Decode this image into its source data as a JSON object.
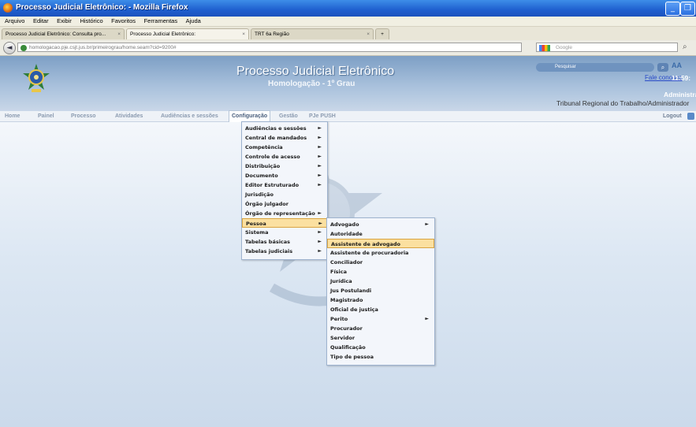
{
  "window": {
    "title": "Processo Judicial Eletrônico: - Mozilla Firefox"
  },
  "menubar": [
    "Arquivo",
    "Editar",
    "Exibir",
    "Histórico",
    "Favoritos",
    "Ferramentas",
    "Ajuda"
  ],
  "tabs": [
    {
      "label": "Processo Judicial Eletrônico: Consulta pro..."
    },
    {
      "label": "Processo Judicial Eletrônico:"
    },
    {
      "label": "TRT 6a Região"
    }
  ],
  "nav": {
    "url": "homologacao.pje.csjt.jus.br/primeirograu/home.seam?cid=9200#",
    "search_placeholder": "Google"
  },
  "header": {
    "title": "Processo Judicial Eletrônico",
    "subtitle": "Homologação - 1º Grau",
    "search_placeholder": "Pesquisar",
    "contact": "Fale conosco",
    "clock": "11:59:",
    "user_role": "Administrad",
    "tribunal": "Tribunal Regional do Trabalho/Administrador"
  },
  "appnav": [
    "Home",
    "Painel",
    "Processo",
    "Atividades",
    "Audiências e sessões",
    "Configuração",
    "Gestão",
    "PJe PUSH"
  ],
  "logout": "Logout",
  "config_menu": [
    {
      "label": "Audiências e sessões",
      "sub": true
    },
    {
      "label": "Central de mandados",
      "sub": true
    },
    {
      "label": "Competência",
      "sub": true
    },
    {
      "label": "Controle de acesso",
      "sub": true
    },
    {
      "label": "Distribuição",
      "sub": true
    },
    {
      "label": "Documento",
      "sub": true
    },
    {
      "label": "Editor Estruturado",
      "sub": true
    },
    {
      "label": "Jurisdição",
      "sub": false
    },
    {
      "label": "Órgão julgador",
      "sub": false
    },
    {
      "label": "Órgão de representação",
      "sub": true
    },
    {
      "label": "Pessoa",
      "sub": true,
      "highlight": true
    },
    {
      "label": "Sistema",
      "sub": true
    },
    {
      "label": "Tabelas básicas",
      "sub": true
    },
    {
      "label": "Tabelas judiciais",
      "sub": true
    }
  ],
  "pessoa_menu": [
    {
      "label": "Advogado",
      "sub": true
    },
    {
      "label": "Autoridade",
      "sub": false
    },
    {
      "label": "Assistente de advogado",
      "sub": false,
      "highlight": true
    },
    {
      "label": "Assistente de procuradoria",
      "sub": false
    },
    {
      "label": "Conciliador",
      "sub": false
    },
    {
      "label": "Física",
      "sub": false
    },
    {
      "label": "Jurídica",
      "sub": false
    },
    {
      "label": "Jus Postulandi",
      "sub": false
    },
    {
      "label": "Magistrado",
      "sub": false
    },
    {
      "label": "Oficial de justiça",
      "sub": false
    },
    {
      "label": "Perito",
      "sub": true
    },
    {
      "label": "Procurador",
      "sub": false
    },
    {
      "label": "Servidor",
      "sub": false
    },
    {
      "label": "Qualificação",
      "sub": false
    },
    {
      "label": "Tipo de pessoa",
      "sub": false
    }
  ],
  "icons": {
    "arrow": "►",
    "back": "◄",
    "close": "×",
    "search": "⌕",
    "min": "_",
    "max": "❐",
    "new_tab": "+"
  },
  "colors": {
    "highlight": "#fbe0a0",
    "header_blue": "#7d9fc5",
    "menu_bg": "#f3f6fb"
  }
}
